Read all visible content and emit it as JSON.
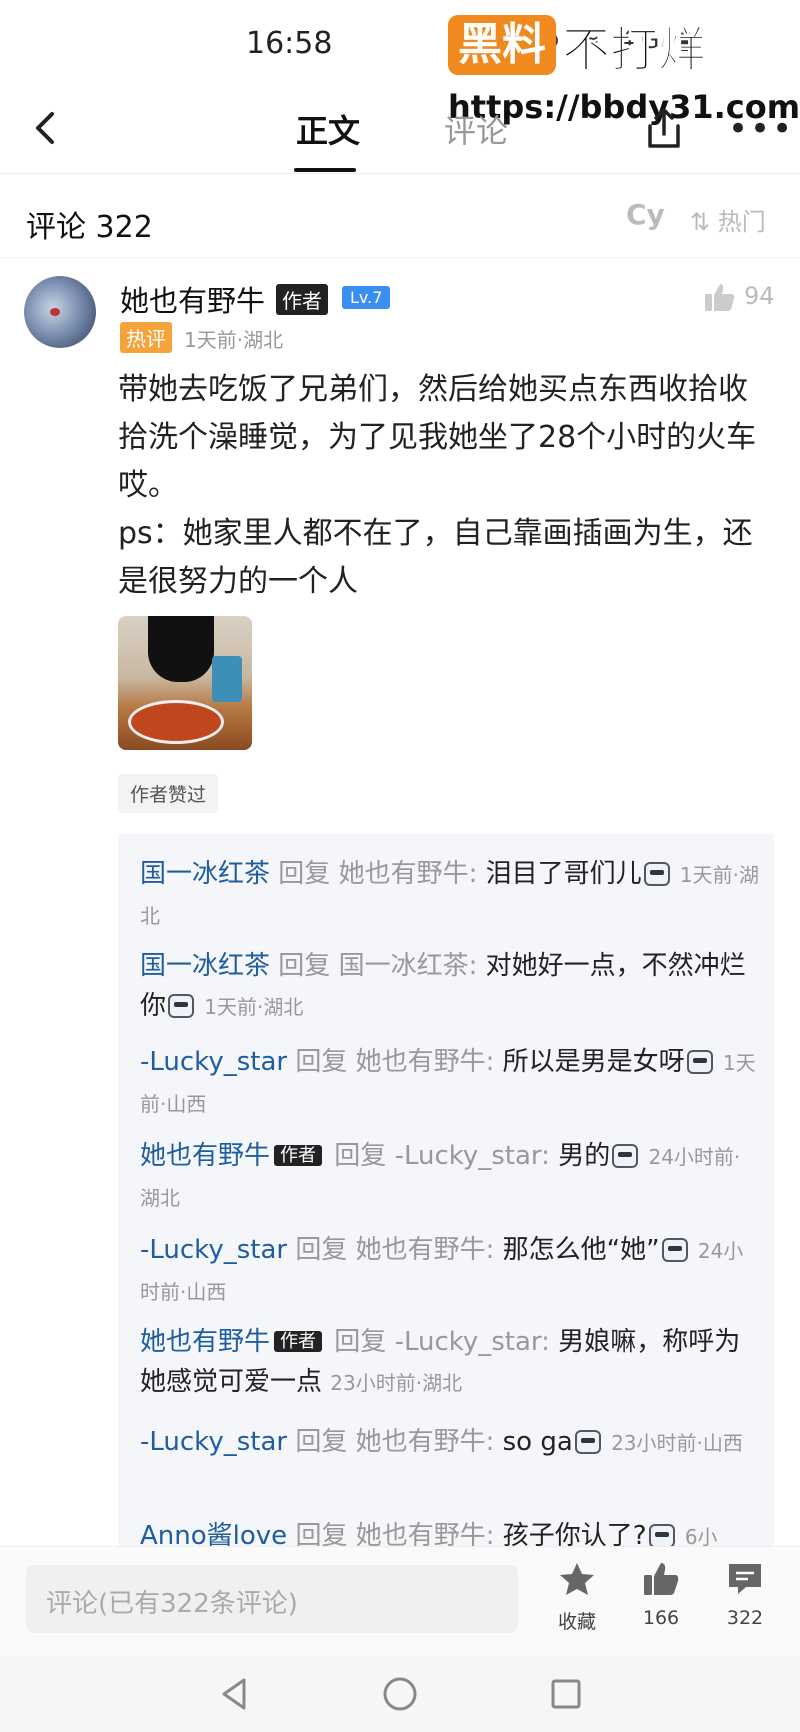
{
  "status_bar": {
    "time": "16:58",
    "icons_text": "⊙ ≈ 4G ▮"
  },
  "watermark": {
    "badge": "黑料",
    "text": "不打烊",
    "url": "https://bbdy31.com"
  },
  "nav": {
    "tab_main": "正文",
    "tab_comments": "评论"
  },
  "comments_header": {
    "title": "评论 322",
    "cy_label": "Cy",
    "sort_label": "热门"
  },
  "main_comment": {
    "user": "她也有野牛",
    "author_tag": "作者",
    "level": "Lv.7",
    "likes": "94",
    "hot_tag": "热评",
    "meta": "1天前·湖北",
    "text": "带她去吃饭了兄弟们，然后给她买点东西收拾收拾洗个澡睡觉，为了见我她坐了28个小时的火车哎。\nps：她家里人都不在了，自己靠画插画为生，还是很努力的一个人",
    "liked_by_author": "作者赞过"
  },
  "replies": [
    {
      "from": "国一冰红茶",
      "reply_word": "回复",
      "to": "她也有野牛:",
      "text": "泪目了哥们儿",
      "time": "1天前·湖北",
      "author": false
    },
    {
      "from": "国一冰红茶",
      "reply_word": "回复",
      "to": "国一冰红茶:",
      "text": "对她好一点，不然冲烂你",
      "time": "1天前·湖北",
      "author": false
    },
    {
      "from": "-Lucky_star",
      "reply_word": "回复",
      "to": "她也有野牛:",
      "text": "所以是男是女呀",
      "time": "1天前·山西",
      "author": false
    },
    {
      "from": "她也有野牛",
      "reply_word": "回复",
      "to": "-Lucky_star:",
      "text": "男的",
      "time": "24小时前·湖北",
      "author": true,
      "author_tag": "作者"
    },
    {
      "from": "-Lucky_star",
      "reply_word": "回复",
      "to": "她也有野牛:",
      "text": "那怎么他“她”",
      "time": "24小时前·山西",
      "author": false
    },
    {
      "from": "她也有野牛",
      "reply_word": "回复",
      "to": "-Lucky_star:",
      "text": "男娘嘛，称呼为她感觉可爱一点",
      "time": "23小时前·湖北",
      "author": true,
      "author_tag": "作者"
    },
    {
      "from": "-Lucky_star",
      "reply_word": "回复",
      "to": "她也有野牛:",
      "text": "so ga",
      "time": "23小时前·山西",
      "author": false
    },
    {
      "from": "Anno酱love",
      "reply_word": "回复",
      "to": "她也有野牛:",
      "text": "孩子你认了?",
      "time": "6小",
      "author": false
    }
  ],
  "bottom_bar": {
    "input_placeholder": "评论(已有322条评论)",
    "favorite_label": "收藏",
    "like_count": "166",
    "comment_count": "322"
  },
  "colors": {
    "link": "#1f5d9e",
    "hot_tag": "#f5a23a",
    "level_tag": "#3a8ef0",
    "watermark": "#f08a1e"
  }
}
